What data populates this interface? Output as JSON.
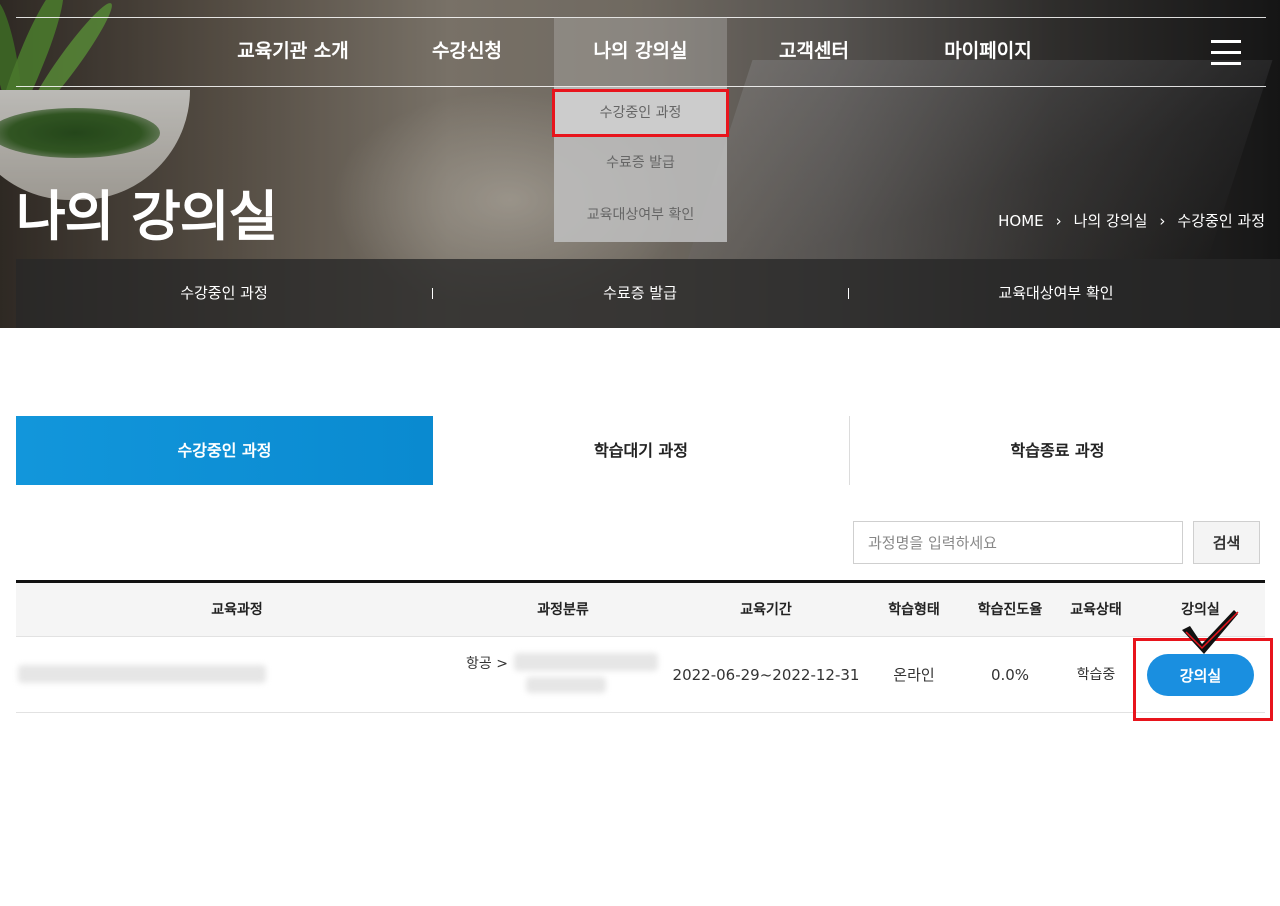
{
  "gnb": {
    "items": [
      {
        "label": "교육기관 소개"
      },
      {
        "label": "수강신청"
      },
      {
        "label": "나의 강의실"
      },
      {
        "label": "고객센터"
      },
      {
        "label": "마이페이지"
      }
    ],
    "active_index": 2,
    "menu_icon": "hamburger-icon"
  },
  "dropdown": {
    "items": [
      {
        "label": "수강중인 과정"
      },
      {
        "label": "수료증 발급"
      },
      {
        "label": "교육대상여부 확인"
      }
    ]
  },
  "hero": {
    "title": "나의 강의실",
    "breadcrumb": [
      "HOME",
      "나의 강의실",
      "수강중인 과정"
    ]
  },
  "subnav": {
    "items": [
      {
        "label": "수강중인 과정"
      },
      {
        "label": "수료증 발급"
      },
      {
        "label": "교육대상여부 확인"
      }
    ]
  },
  "tabs": [
    {
      "label": "수강중인 과정"
    },
    {
      "label": "학습대기 과정"
    },
    {
      "label": "학습종료 과정"
    }
  ],
  "search": {
    "placeholder": "과정명을 입력하세요",
    "button_label": "검색"
  },
  "table": {
    "headers": [
      "교육과정",
      "과정분류",
      "교육기간",
      "학습형태",
      "학습진도율",
      "교육상태",
      "강의실"
    ],
    "rows": [
      {
        "category_prefix": "항공 >",
        "period": "2022-06-29~2022-12-31",
        "type": "온라인",
        "progress": "0.0%",
        "status": "학습중",
        "room_button": "강의실"
      }
    ]
  },
  "colors": {
    "accent_blue": "#1a8fe0",
    "highlight_red": "#e8141c"
  }
}
